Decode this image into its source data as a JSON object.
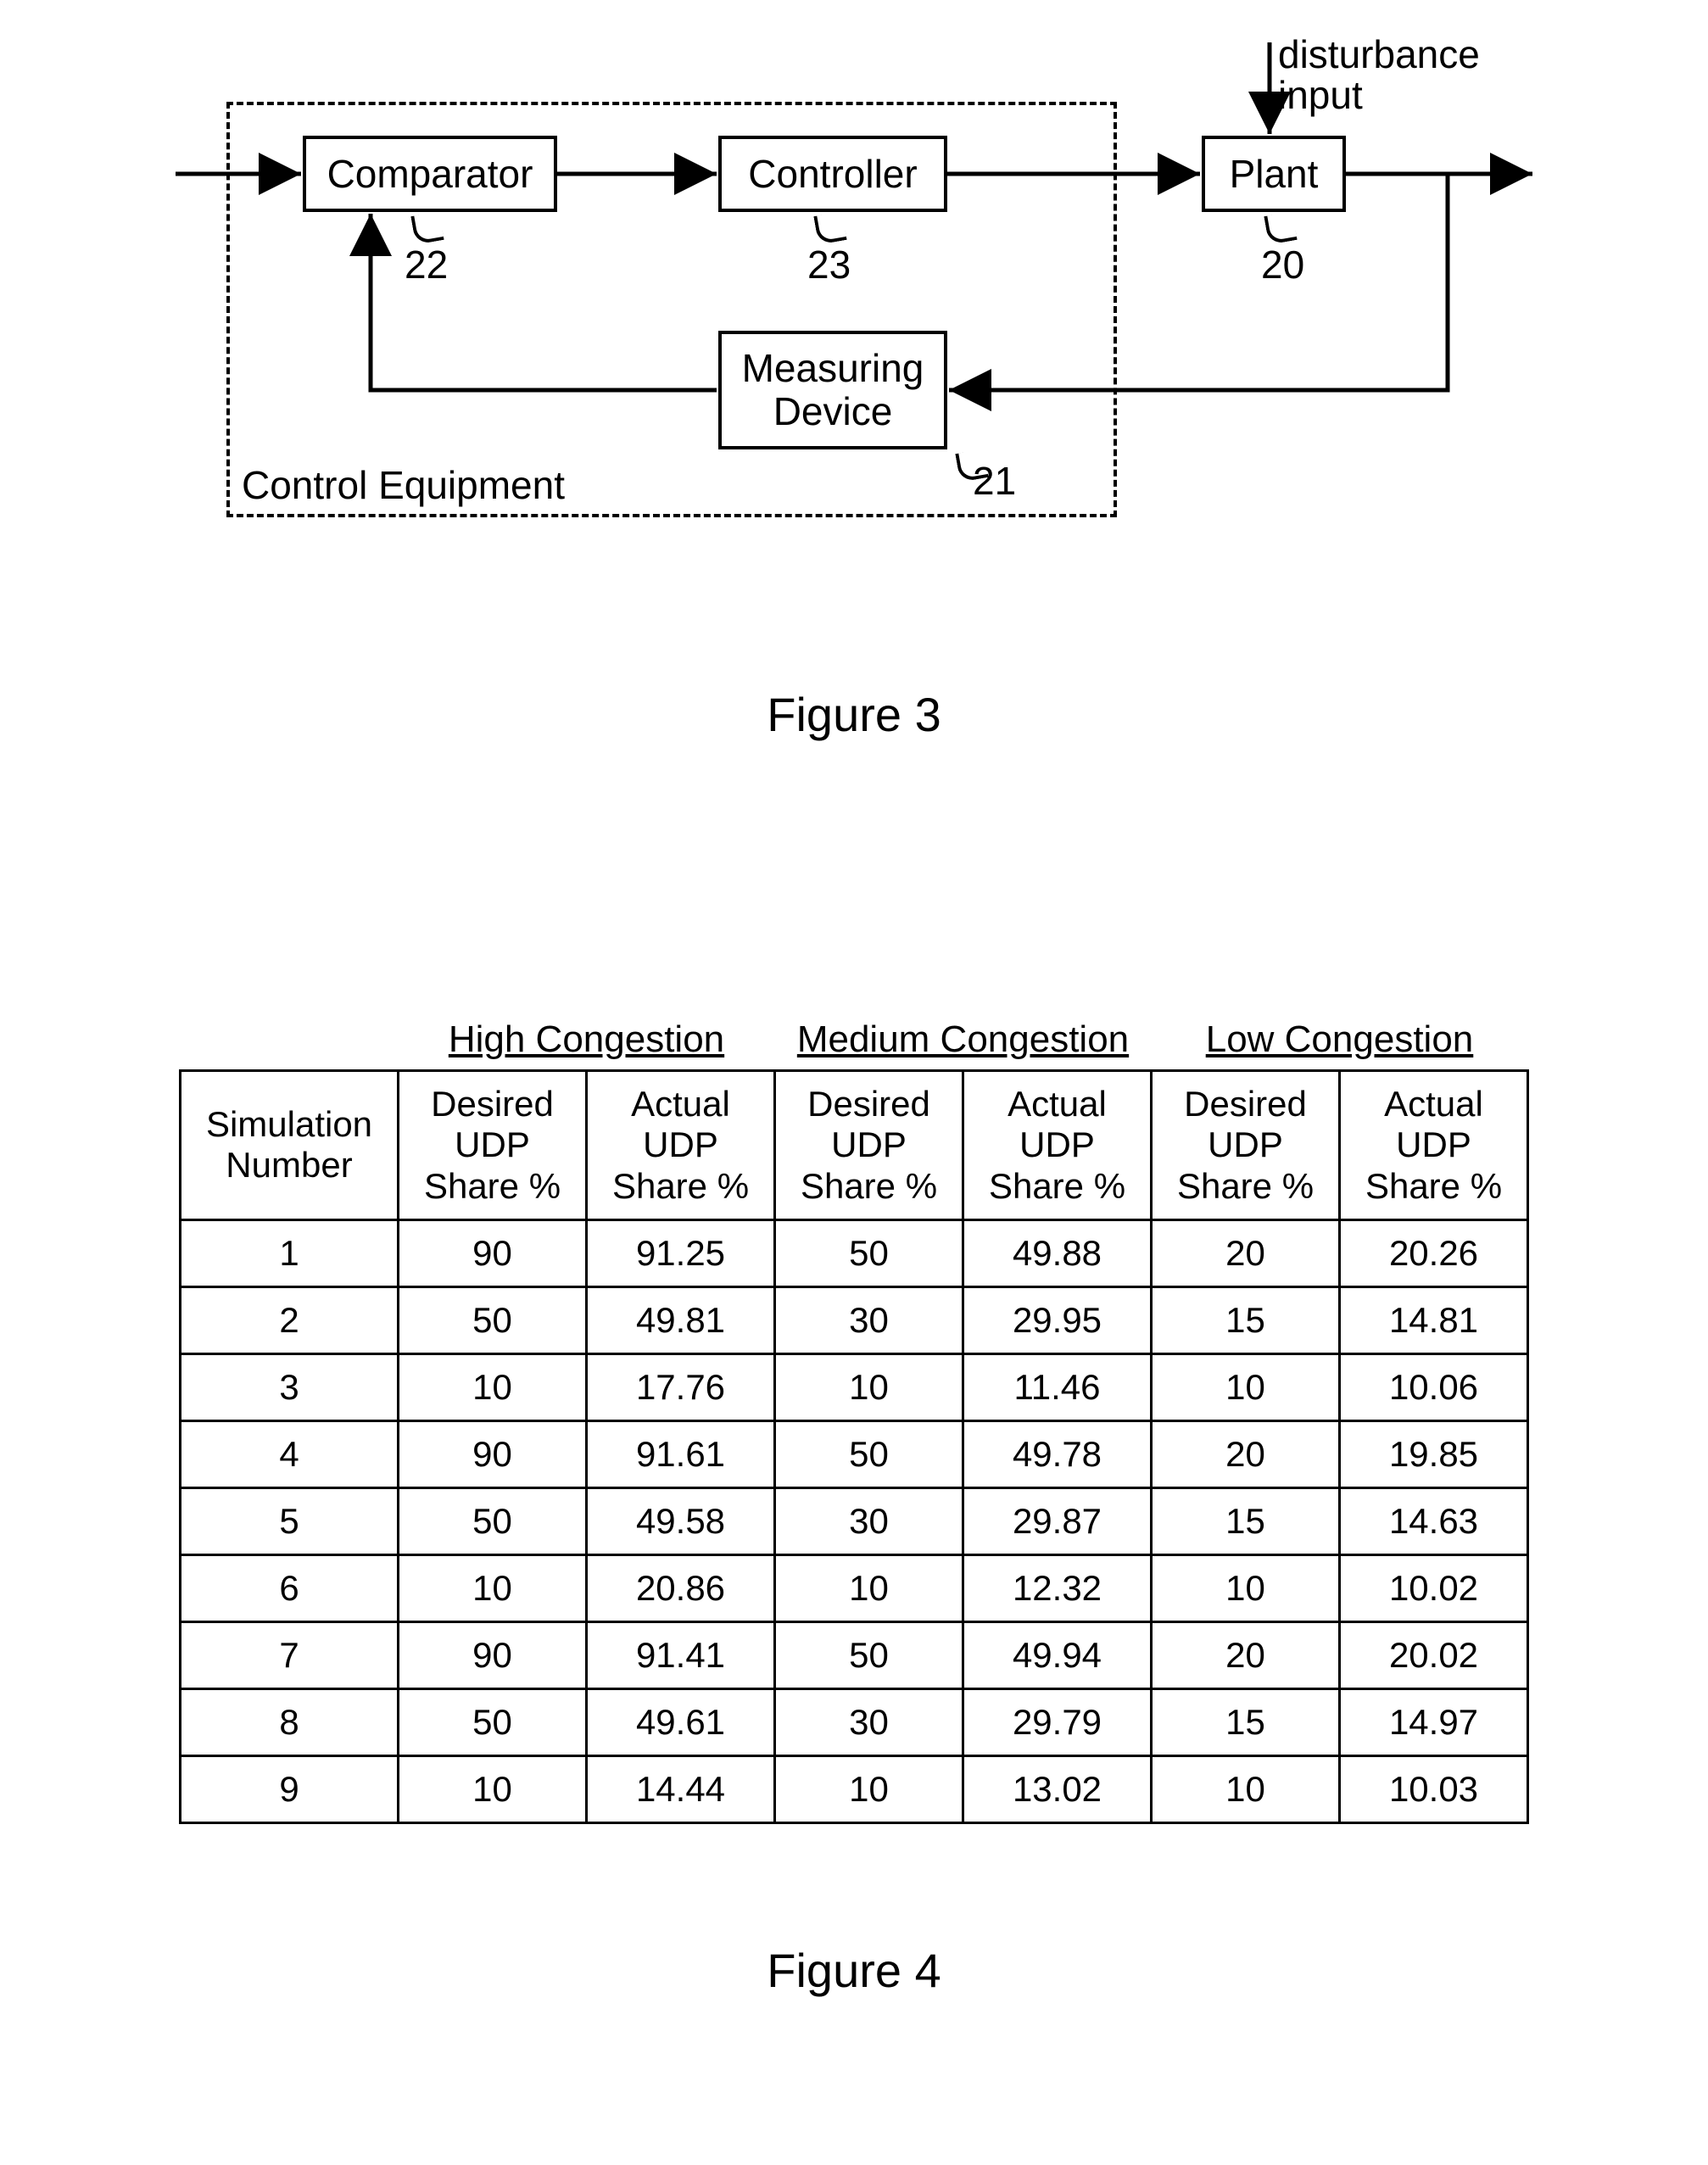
{
  "figure3": {
    "caption": "Figure 3",
    "control_equipment_label": "Control Equipment",
    "disturbance_label": "disturbance\ninput",
    "blocks": {
      "comparator": {
        "label": "Comparator",
        "ref": "22"
      },
      "controller": {
        "label": "Controller",
        "ref": "23"
      },
      "plant": {
        "label": "Plant",
        "ref": "20"
      },
      "measuring": {
        "label": "Measuring\nDevice",
        "ref": "21"
      }
    }
  },
  "figure4": {
    "caption": "Figure 4",
    "sim_header": "Simulation\nNumber",
    "subcol_desired": "Desired\nUDP\nShare %",
    "subcol_actual": "Actual\nUDP\nShare %",
    "groups": [
      "High Congestion",
      "Medium Congestion",
      "Low Congestion"
    ],
    "rows": [
      {
        "n": "1",
        "hd": "90",
        "ha": "91.25",
        "md": "50",
        "ma": "49.88",
        "ld": "20",
        "la": "20.26"
      },
      {
        "n": "2",
        "hd": "50",
        "ha": "49.81",
        "md": "30",
        "ma": "29.95",
        "ld": "15",
        "la": "14.81"
      },
      {
        "n": "3",
        "hd": "10",
        "ha": "17.76",
        "md": "10",
        "ma": "11.46",
        "ld": "10",
        "la": "10.06"
      },
      {
        "n": "4",
        "hd": "90",
        "ha": "91.61",
        "md": "50",
        "ma": "49.78",
        "ld": "20",
        "la": "19.85"
      },
      {
        "n": "5",
        "hd": "50",
        "ha": "49.58",
        "md": "30",
        "ma": "29.87",
        "ld": "15",
        "la": "14.63"
      },
      {
        "n": "6",
        "hd": "10",
        "ha": "20.86",
        "md": "10",
        "ma": "12.32",
        "ld": "10",
        "la": "10.02"
      },
      {
        "n": "7",
        "hd": "90",
        "ha": "91.41",
        "md": "50",
        "ma": "49.94",
        "ld": "20",
        "la": "20.02"
      },
      {
        "n": "8",
        "hd": "50",
        "ha": "49.61",
        "md": "30",
        "ma": "29.79",
        "ld": "15",
        "la": "14.97"
      },
      {
        "n": "9",
        "hd": "10",
        "ha": "14.44",
        "md": "10",
        "ma": "13.02",
        "ld": "10",
        "la": "10.03"
      }
    ]
  },
  "chart_data": {
    "type": "table",
    "title": "UDP Share % by Congestion Level and Simulation",
    "columns": [
      "Simulation Number",
      "High Congestion — Desired UDP Share %",
      "High Congestion — Actual UDP Share %",
      "Medium Congestion — Desired UDP Share %",
      "Medium Congestion — Actual UDP Share %",
      "Low Congestion — Desired UDP Share %",
      "Low Congestion — Actual UDP Share %"
    ],
    "rows": [
      [
        1,
        90,
        91.25,
        50,
        49.88,
        20,
        20.26
      ],
      [
        2,
        50,
        49.81,
        30,
        29.95,
        15,
        14.81
      ],
      [
        3,
        10,
        17.76,
        10,
        11.46,
        10,
        10.06
      ],
      [
        4,
        90,
        91.61,
        50,
        49.78,
        20,
        19.85
      ],
      [
        5,
        50,
        49.58,
        30,
        29.87,
        15,
        14.63
      ],
      [
        6,
        10,
        20.86,
        10,
        12.32,
        10,
        10.02
      ],
      [
        7,
        90,
        91.41,
        50,
        49.94,
        20,
        20.02
      ],
      [
        8,
        50,
        49.61,
        30,
        29.79,
        15,
        14.97
      ],
      [
        9,
        10,
        14.44,
        10,
        13.02,
        10,
        10.03
      ]
    ]
  }
}
